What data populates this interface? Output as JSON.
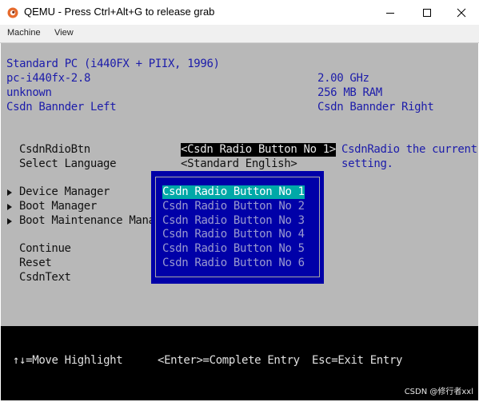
{
  "window": {
    "title": "QEMU - Press Ctrl+Alt+G to release grab",
    "icon": "qemu-logo-icon",
    "controls": [
      "minimize-icon",
      "maximize-icon",
      "close-icon"
    ]
  },
  "menu": [
    "Machine",
    "View"
  ],
  "info": {
    "left": [
      "Standard PC (i440FX + PIIX, 1996)",
      "pc-i440fx-2.8",
      "unknown",
      "Csdn Bannder Left"
    ],
    "right": [
      "2.00 GHz",
      "256 MB RAM",
      "Csdn Bannder Right"
    ]
  },
  "form": {
    "radio_label": "CsdnRdioBtn",
    "radio_value": "<Csdn Radio Button No 1>",
    "language_label": "Select Language",
    "language_value": "<Standard English>",
    "help_line1": "CsdnRadio the current",
    "help_line2": "setting."
  },
  "menu_entries": [
    {
      "label": "Device Manager",
      "submenu": true
    },
    {
      "label": "Boot Manager",
      "submenu": true
    },
    {
      "label": "Boot Maintenance Manag",
      "submenu": true
    },
    {
      "label": "Continue",
      "submenu": false
    },
    {
      "label": "Reset",
      "submenu": false
    },
    {
      "label": "CsdnText",
      "submenu": false
    }
  ],
  "popup": {
    "options": [
      "Csdn Radio Button No 1",
      "Csdn Radio Button No 2",
      "Csdn Radio Button No 3",
      "Csdn Radio Button No 4",
      "Csdn Radio Button No 5",
      "Csdn Radio Button No 6"
    ],
    "selected_index": 0
  },
  "footer": {
    "move": "↑↓=Move Highlight",
    "enter": "<Enter>=Complete Entry",
    "esc": "Esc=Exit Entry"
  },
  "watermark": "CSDN @修行者xxl",
  "colors": {
    "screen_bg": "#b8b8b8",
    "info_text": "#1c1caa",
    "popup_bg": "#0000a8",
    "selected_bg": "#00a8a8"
  }
}
